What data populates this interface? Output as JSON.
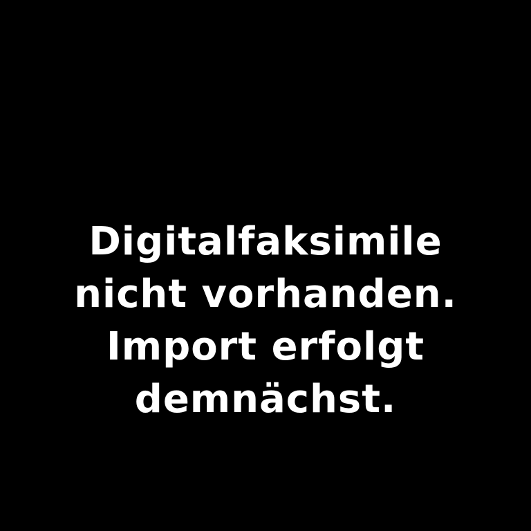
{
  "placeholder": {
    "background_color": "#000000",
    "text_color": "#ffffff",
    "lines": [
      "Digitalfaksimile",
      "nicht vorhanden.",
      "Import erfolgt",
      "demnächst."
    ]
  }
}
